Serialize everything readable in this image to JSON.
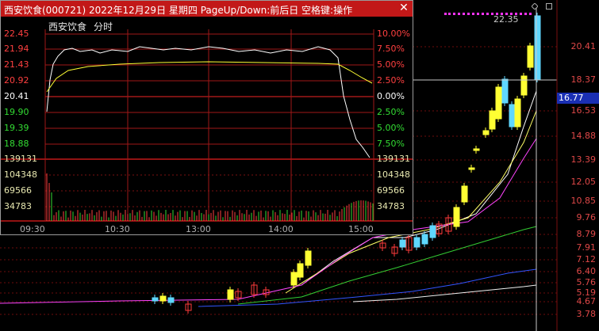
{
  "main_chart": {
    "price_axis": [
      {
        "label": "20.41"
      },
      {
        "label": "18.37"
      },
      {
        "label": "16.53"
      },
      {
        "label": "14.88"
      },
      {
        "label": "13.39"
      },
      {
        "label": "12.05"
      },
      {
        "label": "10.85"
      },
      {
        "label": "9.76"
      },
      {
        "label": "8.79"
      },
      {
        "label": "7.91"
      },
      {
        "label": "7.12"
      },
      {
        "label": "6.40"
      },
      {
        "label": "5.76"
      },
      {
        "label": "5.19"
      },
      {
        "label": "4.67"
      },
      {
        "label": "3.78"
      }
    ],
    "current_price": "16.77",
    "peak_label": "22.35",
    "colors": {
      "up": "#ff3b3b",
      "down": "#5fd7ff",
      "limit": "#ffff33",
      "ma5": "#ffffff",
      "ma10": "#ffff66",
      "ma20": "#ff44ff",
      "ma60": "#33cc33",
      "ma120": "#3355ff",
      "ma250": "#f0f0f0"
    },
    "icons": [
      "diamond-icon",
      "square-icon"
    ]
  },
  "popup": {
    "title": "西安饮食(000721) 2022年12月29日 星期四 PageUp/Down:前后日 空格键:操作",
    "close_icon": "close-icon",
    "stock_name": "西安饮食",
    "mode": "分时",
    "price_labels": [
      "22.45",
      "21.94",
      "21.43",
      "20.92",
      "20.41",
      "19.90",
      "19.39",
      "18.88"
    ],
    "pct_labels": [
      "10.00%",
      "7.50%",
      "5.00%",
      "2.50%",
      "0.00%",
      "2.50%",
      "5.00%",
      "7.50%"
    ],
    "volume_labels": [
      "139131",
      "104348",
      "69566",
      "34783"
    ],
    "time_labels": [
      "09:30",
      "10:30",
      "13:00",
      "14:00",
      "15:00"
    ]
  }
}
